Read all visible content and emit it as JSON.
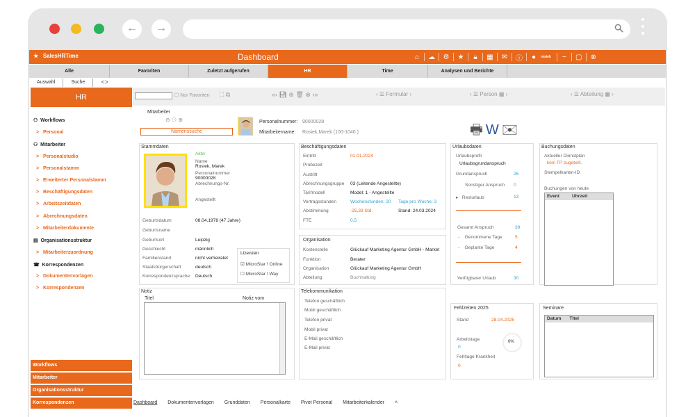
{
  "app": {
    "brand": "SalesHRTime",
    "title": "Dashboard",
    "user": "rosiek",
    "accent": "#e8681c"
  },
  "tabs": [
    "Alle",
    "Favoriten",
    "Zuletzt aufgerufen",
    "HR",
    "Time",
    "Analysen und Berichte"
  ],
  "subtabs": [
    "Auswahl",
    "Suche"
  ],
  "sidebar": {
    "header": "HR",
    "sections": [
      {
        "label": "Workflows",
        "items": [
          "Personal"
        ]
      },
      {
        "label": "Mitarbeiter",
        "items": [
          "Personalstudio",
          "Personalstamm",
          "Erweiterter Personalstamm",
          "Beschäftigungsdaten",
          "Arbeitszeitdaten",
          "Abrechnungsdaten",
          "Mitarbeiterdokumente"
        ]
      },
      {
        "label": "Organisationsstruktur",
        "items": [
          "Mitarbeiterzuordnung"
        ]
      },
      {
        "label": "Korrespondenzen",
        "items": [
          "Dokumentenvorlagen",
          "Korrespondenzen"
        ]
      }
    ],
    "bottom": [
      "Workflows",
      "Mitarbeiter",
      "Organisationsstruktur",
      "Korrespondenzen"
    ]
  },
  "toolbar": {
    "favorites_label": "Nur Favoriten",
    "formular": "Formular",
    "person": "Person",
    "abteilung": "Abteilung"
  },
  "employee": {
    "mitarbeiter_label": "Mitarbeiter",
    "namenssuche": "Namenssuche",
    "personalnummer_label": "Personalnummer:",
    "personalnummer": "90000028",
    "mitarbeitername_label": "Mitarbeitername:",
    "mitarbeitername": "Rosiek,Marek (100-1040 )"
  },
  "stammdaten": {
    "title": "Stammdaten",
    "status": "Aktiv",
    "name_label": "Name",
    "name": "Rosiek, Marek",
    "personalnummer_label": "Personalnummer",
    "personalnummer": "90000028",
    "abrechnungsnr_label": "Abrechnungs-Nr.",
    "anstellt": "Angestellt",
    "rows": [
      {
        "label": "Geburtsdatum",
        "value": "08.04.1978 (47 Jahre)"
      },
      {
        "label": "Geburtsname",
        "value": ""
      },
      {
        "label": "Geburtsort",
        "value": "Leipzig"
      },
      {
        "label": "Geschlecht",
        "value": "männlich"
      },
      {
        "label": "Familienstand",
        "value": "nicht verheiratet"
      },
      {
        "label": "Staatsbürgerschaft",
        "value": "deutsch"
      },
      {
        "label": "Korrespondenzsprache",
        "value": "Deutsch"
      }
    ],
    "lizenzen_label": "Lizenzen",
    "lizenzen": [
      "MicroStar ! Online",
      "MicroStar ! Way"
    ]
  },
  "beschaeftigung": {
    "title": "Beschäftigungsdaten",
    "rows": [
      {
        "label": "Eintritt",
        "value": "01.01.2024"
      },
      {
        "label": "Probezeit",
        "value": ""
      },
      {
        "label": "Austritt",
        "value": ""
      },
      {
        "label": "Abrechnungsgruppe",
        "value": "03 (Leitende Angestellte)"
      },
      {
        "label": "Tarifmodell",
        "value": "Model: 1 - Angestellte"
      },
      {
        "label": "Vertragsstunden",
        "value": "Wochenstunden: 20",
        "extra": "Tage pro Woche: 3"
      },
      {
        "label": "Abstimmung",
        "value": "-25,33 Std.",
        "extra": "Stand: 24.03.2024"
      },
      {
        "label": "FTE",
        "value": "0,5"
      }
    ]
  },
  "organisation": {
    "title": "Organisation",
    "rows": [
      {
        "label": "Kostenstelle",
        "value": "Glückauf Marketing Agentur GmbH - Market"
      },
      {
        "label": "Funktion",
        "value": "Berater"
      },
      {
        "label": "Organisation",
        "value": "Glückauf Marketing Agentur GmbH"
      },
      {
        "label": "Abteilung",
        "value": "Buchhaltung"
      }
    ]
  },
  "telekom": {
    "title": "Telekommunikation",
    "rows": [
      "Telefon geschäftlich",
      "Mobil geschäftlich",
      "Telefon privat",
      "Mobil privat",
      "E-Mail geschäftlich",
      "E-Mail privat"
    ]
  },
  "notiz": {
    "title": "Notiz",
    "col_titel": "Titel",
    "col_notiz": "Notiz vom"
  },
  "urlaub": {
    "title": "Urlaubsdaten",
    "profil_label": "Urlaubsprofil",
    "profil": "Urlaubsgrundanspruch",
    "grund_label": "Grundanspruch",
    "grund": "26",
    "sonst_label": "Sonstiger Anspruch",
    "sonst": "0",
    "rest_label": "Resturlaub",
    "rest": "13",
    "gesamt_label": "Gesamt Anspruch",
    "gesamt": "39",
    "genommen_label": "Genommene Tage",
    "genommen": "5",
    "geplant_label": "Geplante Tage",
    "geplant": "4",
    "verfuegbar_label": "Verfügbarer Urlaub",
    "verfuegbar": "30"
  },
  "fehlzeiten": {
    "title": "Fehlzeiten 2025",
    "stand_label": "Stand",
    "stand": "28.04.2025",
    "arbeitstage_label": "Arbeitstage",
    "arbeitstage": "0",
    "percent": "0%",
    "krank_label": "Fehltage Krankheit",
    "krank": "0"
  },
  "buchung": {
    "title": "Buchungsdaten",
    "dienstplan_label": "Aktueller Dienstplan",
    "dienstplan": "kein TP zugeteilt.",
    "stempel": "Stempelkarten-ID",
    "heute": "Buchungen von heute",
    "col_event": "Event",
    "col_uhrzeit": "Uhrzeit"
  },
  "seminare": {
    "title": "Seminare",
    "col_datum": "Datum",
    "col_titel": "Titel"
  },
  "bottomtabs": [
    "Dashboard",
    "Dokumentenvorlagen",
    "Grunddaten",
    "Personalkarte",
    "Pivot Personal",
    "Mitarbeiterkalender",
    "˄"
  ]
}
